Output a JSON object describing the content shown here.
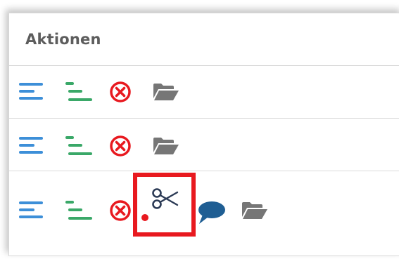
{
  "table": {
    "column_header": "Aktionen",
    "rows": [
      {
        "actions": [
          "align-left-icon",
          "align-indent-icon",
          "cancel-icon",
          "folder-open-icon"
        ]
      },
      {
        "actions": [
          "align-left-icon",
          "align-indent-icon",
          "cancel-icon",
          "folder-open-icon"
        ]
      },
      {
        "actions": [
          "align-left-icon",
          "align-indent-icon",
          "cancel-icon",
          "scissors-icon",
          "comment-icon",
          "folder-open-icon"
        ],
        "highlighted": "scissors-icon"
      }
    ]
  },
  "colors": {
    "blue_icon": "#3d8fd8",
    "green_icon": "#3aa868",
    "red_icon": "#e8191f",
    "folder_icon": "#767676",
    "comment_icon": "#1f5e93",
    "scissors_icon": "#2b3a55",
    "highlight": "#e8191f"
  }
}
